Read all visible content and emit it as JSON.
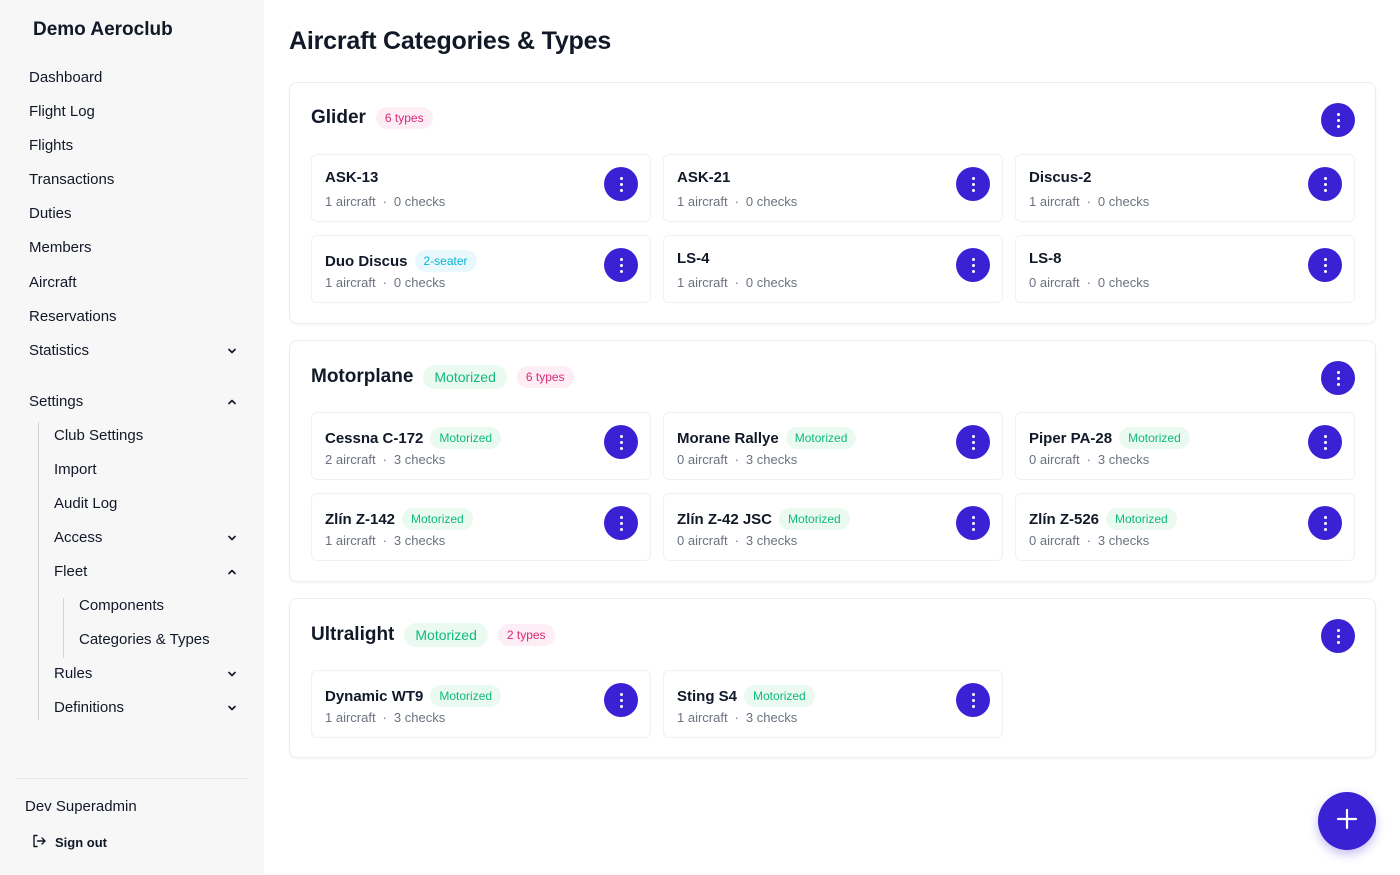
{
  "sidebar": {
    "club_name": "Demo Aeroclub",
    "nav": [
      {
        "label": "Dashboard"
      },
      {
        "label": "Flight Log"
      },
      {
        "label": "Flights"
      },
      {
        "label": "Transactions"
      },
      {
        "label": "Duties"
      },
      {
        "label": "Members"
      },
      {
        "label": "Aircraft"
      },
      {
        "label": "Reservations"
      },
      {
        "label": "Statistics",
        "icon": "chevron-down-icon"
      },
      {
        "label": "Settings",
        "icon": "chevron-up-icon"
      },
      {
        "label": "Club Settings"
      },
      {
        "label": "Import"
      },
      {
        "label": "Audit Log"
      },
      {
        "label": "Access",
        "icon": "chevron-down-icon"
      },
      {
        "label": "Fleet",
        "icon": "chevron-up-icon"
      },
      {
        "label": "Components"
      },
      {
        "label": "Categories & Types"
      },
      {
        "label": "Rules",
        "icon": "chevron-down-icon"
      },
      {
        "label": "Definitions",
        "icon": "chevron-down-icon"
      }
    ],
    "user_name": "Dev Superadmin",
    "sign_out": "Sign out"
  },
  "page_title": "Aircraft Categories & Types",
  "dot": "·",
  "sections": [
    {
      "title": "Glider",
      "badges": [
        "6 types"
      ],
      "types": [
        {
          "name": "ASK-13",
          "aircraft": "1 aircraft",
          "checks": "0 checks"
        },
        {
          "name": "ASK-21",
          "aircraft": "1 aircraft",
          "checks": "0 checks"
        },
        {
          "name": "Discus-2",
          "aircraft": "1 aircraft",
          "checks": "0 checks"
        },
        {
          "name": "Duo Discus",
          "badge": "2-seater",
          "aircraft": "1 aircraft",
          "checks": "0 checks"
        },
        {
          "name": "LS-4",
          "aircraft": "1 aircraft",
          "checks": "0 checks"
        },
        {
          "name": "LS-8",
          "aircraft": "0 aircraft",
          "checks": "0 checks"
        }
      ]
    },
    {
      "title": "Motorplane",
      "badges": [
        "Motorized",
        "6 types"
      ],
      "types": [
        {
          "name": "Cessna C-172",
          "badge": "Motorized",
          "aircraft": "2 aircraft",
          "checks": "3 checks"
        },
        {
          "name": "Morane Rallye",
          "badge": "Motorized",
          "aircraft": "0 aircraft",
          "checks": "3 checks"
        },
        {
          "name": "Piper PA-28",
          "badge": "Motorized",
          "aircraft": "0 aircraft",
          "checks": "3 checks"
        },
        {
          "name": "Zlín Z-142",
          "badge": "Motorized",
          "aircraft": "1 aircraft",
          "checks": "3 checks"
        },
        {
          "name": "Zlín Z-42 JSC",
          "badge": "Motorized",
          "aircraft": "0 aircraft",
          "checks": "3 checks"
        },
        {
          "name": "Zlín Z-526",
          "badge": "Motorized",
          "aircraft": "0 aircraft",
          "checks": "3 checks"
        }
      ]
    },
    {
      "title": "Ultralight",
      "badges": [
        "Motorized",
        "2 types"
      ],
      "types": [
        {
          "name": "Dynamic WT9",
          "badge": "Motorized",
          "aircraft": "1 aircraft",
          "checks": "3 checks"
        },
        {
          "name": "Sting S4",
          "badge": "Motorized",
          "aircraft": "1 aircraft",
          "checks": "3 checks"
        }
      ]
    }
  ],
  "icons": {
    "kebab": "more-vertical-icon",
    "fab": "plus-icon",
    "sign_out": "sign-out-icon"
  },
  "colors": {
    "accent": "#3b21d4",
    "motorized_text": "#10b981",
    "types_badge_text": "#db2777",
    "seater_badge_text": "#06b6d4"
  }
}
